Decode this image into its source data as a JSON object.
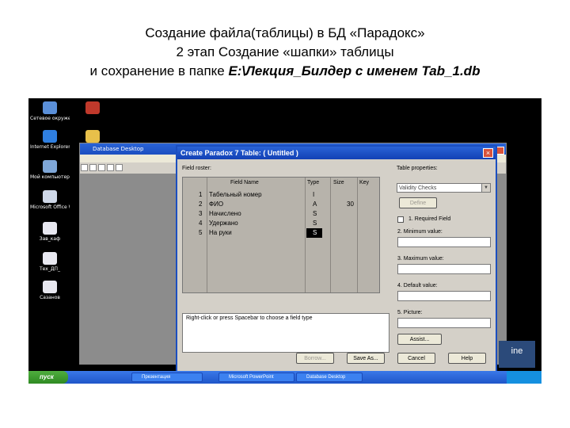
{
  "slide": {
    "title_line1": "Создание файла(таблицы) в БД «Парадокс»",
    "title_line2": "2 этап Создание «шапки» таблицы",
    "title_line3_prefix": "и сохранение в папке ",
    "title_line3_bold": "E:\\Лекция_Билдер с именем Tab_1.db"
  },
  "desktop_icons": [
    {
      "label": "Сетевое окружение"
    },
    {
      "label": "Internet Explorer"
    },
    {
      "label": "Мой компьютер"
    },
    {
      "label": "Microsoft Office W..."
    },
    {
      "label": "Зав_каф"
    },
    {
      "label": "Тех_ДП_"
    },
    {
      "label": "Сазанов"
    }
  ],
  "background_window": {
    "title": "Database Desktop"
  },
  "dialog": {
    "title": "Create Paradox 7 Table: ( Untitled )",
    "close_icon": "×",
    "field_roster_label": "Field roster:",
    "columns": [
      "Field Name",
      "Type",
      "Size",
      "Key"
    ],
    "rows": [
      {
        "num": "1",
        "name": "Табельный номер",
        "type": "I",
        "size": "",
        "key": ""
      },
      {
        "num": "2",
        "name": "ФИО",
        "type": "A",
        "size": "30",
        "key": ""
      },
      {
        "num": "3",
        "name": "Начислено",
        "type": "S",
        "size": "",
        "key": ""
      },
      {
        "num": "4",
        "name": "Удержано",
        "type": "S",
        "size": "",
        "key": ""
      },
      {
        "num": "5",
        "name": "На руки",
        "type": "S",
        "size": "",
        "key": ""
      }
    ],
    "hint": "Right-click or press Spacebar to choose a field type",
    "table_properties_label": "Table properties:",
    "table_properties_value": "Validity Checks",
    "define_button": "Define",
    "required_field_label": "1. Required Field",
    "minimum_value_label": "2. Minimum value:",
    "maximum_value_label": "3. Maximum value:",
    "default_value_label": "4. Default value:",
    "picture_label": "5. Picture:",
    "assist_button": "Assist...",
    "borrow_button": "Borrow...",
    "save_as_button": "Save As...",
    "cancel_button": "Cancel",
    "help_button": "Help"
  },
  "taskbar": {
    "start_label": "пуск",
    "tasks": [
      "Презентация",
      "Microsoft PowerPoint",
      "Database Desktop"
    ]
  },
  "colors": {
    "xp_blue": "#1c4fc0",
    "dialog_face": "#d4d0c8",
    "start_green": "#3b9a2e"
  }
}
